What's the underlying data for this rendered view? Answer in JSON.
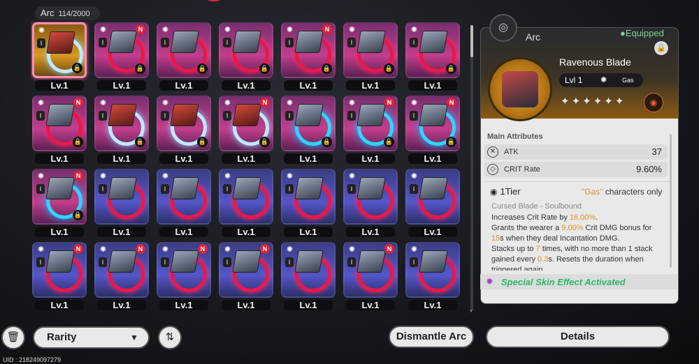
{
  "header": {
    "title": "Arc",
    "count": "114/2000"
  },
  "grid": {
    "level_label": "Lv.1",
    "rows": [
      [
        {
          "rarity": "gold",
          "new": false,
          "ring": "swirl",
          "art": "red",
          "selected": true
        },
        {
          "rarity": "purple",
          "new": true,
          "ring": "red",
          "art": "grey"
        },
        {
          "rarity": "purple",
          "new": false,
          "ring": "red",
          "art": "grey"
        },
        {
          "rarity": "purple",
          "new": false,
          "ring": "red",
          "art": "grey"
        },
        {
          "rarity": "purple",
          "new": true,
          "ring": "red",
          "art": "grey"
        },
        {
          "rarity": "purple",
          "new": false,
          "ring": "red",
          "art": "grey"
        },
        {
          "rarity": "purple",
          "new": false,
          "ring": "red",
          "art": "grey"
        }
      ],
      [
        {
          "rarity": "purple",
          "new": true,
          "ring": "red",
          "art": "grey"
        },
        {
          "rarity": "purple",
          "new": false,
          "ring": "swirl",
          "art": "red"
        },
        {
          "rarity": "purple",
          "new": false,
          "ring": "swirl",
          "art": "red"
        },
        {
          "rarity": "purple",
          "new": true,
          "ring": "swirl",
          "art": "red"
        },
        {
          "rarity": "purple",
          "new": false,
          "ring": "cyan",
          "art": "grey"
        },
        {
          "rarity": "purple",
          "new": true,
          "ring": "cyan",
          "art": "grey"
        },
        {
          "rarity": "purple",
          "new": true,
          "ring": "cyan",
          "art": "grey"
        }
      ],
      [
        {
          "rarity": "purple",
          "new": true,
          "ring": "cyan",
          "art": "grey"
        },
        {
          "rarity": "blue",
          "new": false,
          "ring": "red",
          "art": "grey"
        },
        {
          "rarity": "blue",
          "new": false,
          "ring": "red",
          "art": "grey"
        },
        {
          "rarity": "blue",
          "new": false,
          "ring": "red",
          "art": "grey"
        },
        {
          "rarity": "blue",
          "new": false,
          "ring": "red",
          "art": "grey"
        },
        {
          "rarity": "blue",
          "new": false,
          "ring": "red",
          "art": "grey"
        },
        {
          "rarity": "blue",
          "new": false,
          "ring": "red",
          "art": "grey"
        }
      ],
      [
        {
          "rarity": "blue",
          "new": true,
          "ring": "red",
          "art": "grey"
        },
        {
          "rarity": "blue",
          "new": true,
          "ring": "red",
          "art": "grey"
        },
        {
          "rarity": "blue",
          "new": true,
          "ring": "red",
          "art": "grey"
        },
        {
          "rarity": "blue",
          "new": true,
          "ring": "red",
          "art": "grey"
        },
        {
          "rarity": "blue",
          "new": false,
          "ring": "red",
          "art": "grey"
        },
        {
          "rarity": "blue",
          "new": true,
          "ring": "red",
          "art": "grey"
        },
        {
          "rarity": "blue",
          "new": false,
          "ring": "red",
          "art": "grey"
        }
      ]
    ]
  },
  "detail": {
    "category": "Arc",
    "equipped": "Equipped",
    "name": "Ravenous Blade",
    "level": "Lvl 1",
    "element": "Gas",
    "stars": "✦✦✦✦✦✦",
    "main_attributes_label": "Main Attributes",
    "stats": [
      {
        "name": "ATK",
        "value": "37",
        "icon": "atk-icon"
      },
      {
        "name": "CRIT Rate",
        "value": "9.60%",
        "icon": "crit-icon"
      }
    ],
    "tier": "1Tier",
    "condition_prefix": "\"Gas\"",
    "condition_suffix": " characters only",
    "effect_title": "Cursed Blade - Soulbound",
    "effect_segments": [
      {
        "t": "Increases Crit Rate by "
      },
      {
        "t": "16.00%",
        "hl": true
      },
      {
        "t": "."
      },
      {
        "br": true
      },
      {
        "t": "Grants the wearer a "
      },
      {
        "t": "9.00%",
        "hl": true
      },
      {
        "t": " Crit DMG bonus for "
      },
      {
        "t": "15",
        "hl": true
      },
      {
        "t": "s when they deal Incantation DMG."
      },
      {
        "br": true
      },
      {
        "t": "Stacks up to "
      },
      {
        "t": "7",
        "hl": true
      },
      {
        "t": " times, with no more than 1 stack gained every "
      },
      {
        "t": "0.3",
        "hl": true
      },
      {
        "t": "s. Resets the duration when triggered again."
      }
    ],
    "special": "Special Skin Effect Activated"
  },
  "footer": {
    "rarity_label": "Rarity",
    "dismantle_label": "Dismantle Arc",
    "details_label": "Details",
    "uid": "UID : 218249097279"
  },
  "colors": {
    "accent_green": "#7fd39a",
    "highlight": "#e09020",
    "new_badge": "#e0223a"
  }
}
